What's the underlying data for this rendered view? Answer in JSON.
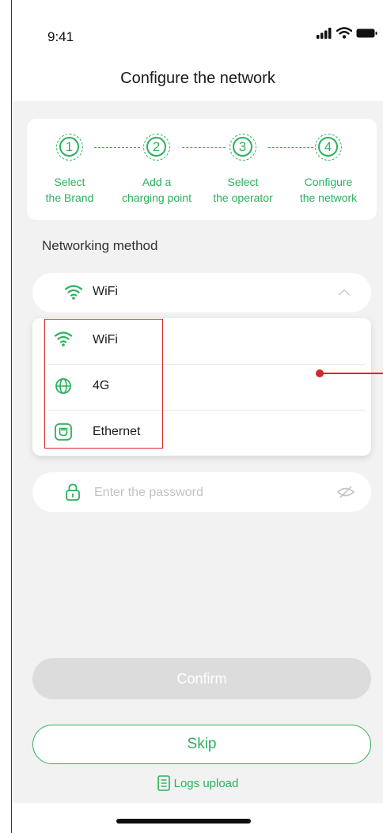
{
  "status_bar": {
    "time": "9:41"
  },
  "header": {
    "title": "Configure the network"
  },
  "steps": [
    {
      "number": "1",
      "line1": "Select",
      "line2": "the Brand"
    },
    {
      "number": "2",
      "line1": "Add a",
      "line2": "charging point"
    },
    {
      "number": "3",
      "line1": "Select",
      "line2": "the operator"
    },
    {
      "number": "4",
      "line1": "Configure",
      "line2": "the network"
    }
  ],
  "networking": {
    "label": "Networking method",
    "selected": "WiFi",
    "selected_icon": "wifi-icon",
    "options": [
      {
        "label": "WiFi",
        "icon": "wifi-icon"
      },
      {
        "label": "4G",
        "icon": "globe-icon"
      },
      {
        "label": "Ethernet",
        "icon": "ethernet-port-icon"
      }
    ]
  },
  "password": {
    "placeholder": "Enter the password",
    "icon": "lock-icon",
    "toggle_icon": "eye-off-icon"
  },
  "buttons": {
    "confirm": "Confirm",
    "skip": "Skip"
  },
  "logs": {
    "label": "Logs upload",
    "icon": "document-icon"
  },
  "colors": {
    "accent": "#2bb15b",
    "disabled": "#dcdcdc",
    "annotation": "#d9262b",
    "background": "#f2f2f2"
  }
}
